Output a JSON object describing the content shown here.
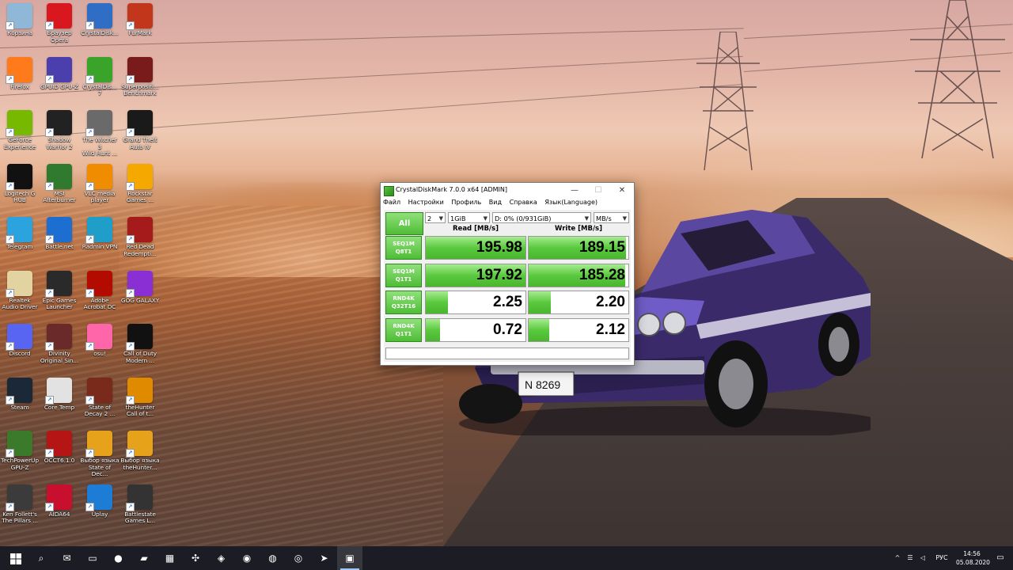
{
  "desktop": {
    "icons": [
      {
        "label": "Корзина",
        "icon": "recycle-bin-icon",
        "color": "#8fb8d8"
      },
      {
        "label": "Браузер\nOpera",
        "icon": "opera-icon",
        "color": "#d9171e"
      },
      {
        "label": "CrystalDisk...",
        "icon": "crystaldiskinfo-icon",
        "color": "#2f6ec4"
      },
      {
        "label": "FurMark",
        "icon": "furmark-icon",
        "color": "#c2371b"
      },
      {
        "label": "Firefox",
        "icon": "firefox-icon",
        "color": "#ff7a1a"
      },
      {
        "label": "GPUID GPU-Z",
        "icon": "gpuz-icon",
        "color": "#4b3fae"
      },
      {
        "label": "CrystalDis...\n7",
        "icon": "crystaldiskmark-icon",
        "color": "#39a32a"
      },
      {
        "label": "Superpositi...\nBenchmark",
        "icon": "superposition-icon",
        "color": "#7a1b1b"
      },
      {
        "label": "GeForce\nExperience",
        "icon": "geforce-icon",
        "color": "#76b900"
      },
      {
        "label": "Shadow\nWarrior 2",
        "icon": "shadow-warrior-icon",
        "color": "#222222"
      },
      {
        "label": "The Witcher 3\nWild Hunt ...",
        "icon": "witcher-icon",
        "color": "#6a6a6a"
      },
      {
        "label": "Grand Theft\nAuto IV",
        "icon": "gta-iv-icon",
        "color": "#1a1a1a"
      },
      {
        "label": "Logitech G\nHUB",
        "icon": "logitech-icon",
        "color": "#111111"
      },
      {
        "label": "MSI\nAfterburner",
        "icon": "afterburner-icon",
        "color": "#2f7a2f"
      },
      {
        "label": "VLC media\nplayer",
        "icon": "vlc-icon",
        "color": "#f08c00"
      },
      {
        "label": "Rockstar\nGames ...",
        "icon": "rockstar-icon",
        "color": "#f5a800"
      },
      {
        "label": "Telegram",
        "icon": "telegram-icon",
        "color": "#2aa3df"
      },
      {
        "label": "Battle.net",
        "icon": "battlenet-icon",
        "color": "#1c6fd1"
      },
      {
        "label": "Radmin VPN",
        "icon": "radmin-icon",
        "color": "#1f9ec9"
      },
      {
        "label": "Red Dead\nRedempti...",
        "icon": "rdr-icon",
        "color": "#a51b1b"
      },
      {
        "label": "Realtek\nAudio Driver",
        "icon": "realtek-icon",
        "color": "#e3d3a0"
      },
      {
        "label": "Epic Games\nLauncher",
        "icon": "epic-games-icon",
        "color": "#2a2a2a"
      },
      {
        "label": "Adobe\nAcrobat DC",
        "icon": "acrobat-icon",
        "color": "#b30b00"
      },
      {
        "label": "GOG GALAXY",
        "icon": "gog-icon",
        "color": "#8a2fd4"
      },
      {
        "label": "Discord",
        "icon": "discord-icon",
        "color": "#5865f2"
      },
      {
        "label": "Divinity\nOriginal Sin...",
        "icon": "divinity-icon",
        "color": "#6b2a2a"
      },
      {
        "label": "osu!",
        "icon": "osu-icon",
        "color": "#ff66aa"
      },
      {
        "label": "Call of Duty\nModern ...",
        "icon": "cod-icon",
        "color": "#111111"
      },
      {
        "label": "Steam",
        "icon": "steam-icon",
        "color": "#1b2838"
      },
      {
        "label": "Core Temp",
        "icon": "coretemp-icon",
        "color": "#e2e2e2"
      },
      {
        "label": "State of\nDecay 2 ...",
        "icon": "state-of-decay-icon",
        "color": "#7a2a1a"
      },
      {
        "label": "theHunter\nCall of t...",
        "icon": "thehunter-icon",
        "color": "#e08a00"
      },
      {
        "label": "TechPowerUp\nGPU-Z",
        "icon": "techpowerup-icon",
        "color": "#3a7a2a"
      },
      {
        "label": "OCCT6.1.0",
        "icon": "occt-icon",
        "color": "#b51515"
      },
      {
        "label": "Выбор языка\nState of Dec...",
        "icon": "language-select-icon",
        "color": "#e5a21a"
      },
      {
        "label": "Выбор языка\ntheHunter...",
        "icon": "language-select-icon",
        "color": "#e5a21a"
      },
      {
        "label": "Ken Follett's\nThe Pillars ...",
        "icon": "pillars-icon",
        "color": "#3b3b3b"
      },
      {
        "label": "AIDA64",
        "icon": "aida64-icon",
        "color": "#c8102e"
      },
      {
        "label": "Uplay",
        "icon": "uplay-icon",
        "color": "#1c7cd6"
      },
      {
        "label": "Battlestate\nGames L...",
        "icon": "battlestate-icon",
        "color": "#333333"
      }
    ]
  },
  "window": {
    "title": "CrystalDiskMark 7.0.0 x64 [ADMIN]",
    "controls": {
      "minimize": "—",
      "maximize": "☐",
      "close": "✕"
    },
    "menu": [
      "Файл",
      "Настройки",
      "Профиль",
      "Вид",
      "Справка",
      "Язык(Language)"
    ],
    "all_button": "All",
    "count": "2",
    "size": "1GiB",
    "drive": "D: 0% (0/931GiB)",
    "unit": "MB/s",
    "read_header": "Read [MB/s]",
    "write_header": "Write [MB/s]",
    "rows": [
      {
        "line1": "SEQ1M",
        "line2": "Q8T1",
        "read": "195.98",
        "write": "189.15",
        "read_fill": 1.0,
        "write_fill": 0.98
      },
      {
        "line1": "SEQ1M",
        "line2": "Q1T1",
        "read": "197.92",
        "write": "185.28",
        "read_fill": 1.0,
        "write_fill": 0.97
      },
      {
        "line1": "RND4K",
        "line2": "Q32T16",
        "read": "2.25",
        "write": "2.20",
        "read_fill": 0.22,
        "write_fill": 0.22
      },
      {
        "line1": "RND4K",
        "line2": "Q1T1",
        "read": "0.72",
        "write": "2.12",
        "read_fill": 0.14,
        "write_fill": 0.21
      }
    ],
    "comment": ""
  },
  "taskbar": {
    "start_icon": "windows-start-icon",
    "pinned": [
      {
        "icon": "search-icon",
        "glyph": "⌕"
      },
      {
        "icon": "mail-icon",
        "glyph": "✉"
      },
      {
        "icon": "file-explorer-icon",
        "glyph": "▭"
      },
      {
        "icon": "firefox-icon",
        "glyph": "●"
      },
      {
        "icon": "folder-icon",
        "glyph": "▰"
      },
      {
        "icon": "gpuz-icon",
        "glyph": "▦"
      },
      {
        "icon": "afterburner-icon",
        "glyph": "✣"
      },
      {
        "icon": "superposition-icon",
        "glyph": "◈"
      },
      {
        "icon": "discord-icon",
        "glyph": "◉"
      },
      {
        "icon": "steam-icon",
        "glyph": "◍"
      },
      {
        "icon": "network-icon",
        "glyph": "◎"
      },
      {
        "icon": "telegram-icon",
        "glyph": "➤"
      },
      {
        "icon": "crystaldiskmark-icon",
        "glyph": "▣"
      }
    ],
    "tray": {
      "chevron": "^",
      "language": "РУС",
      "time": "14:56",
      "date": "05.08.2020"
    }
  }
}
